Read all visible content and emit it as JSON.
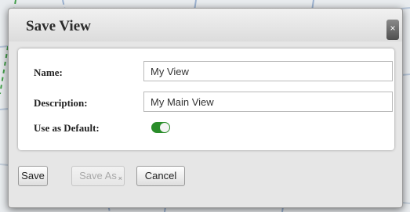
{
  "dialog": {
    "title": "Save View",
    "close_icon": "×",
    "fields": {
      "name_label": "Name:",
      "name_value": "My View",
      "description_label": "Description:",
      "description_value": "My Main View",
      "default_label": "Use as Default:",
      "default_on": true
    },
    "buttons": {
      "save": "Save",
      "save_as": "Save As",
      "save_as_badge": "×",
      "cancel": "Cancel"
    }
  },
  "colors": {
    "toggle_on": "#2a8d2a"
  }
}
